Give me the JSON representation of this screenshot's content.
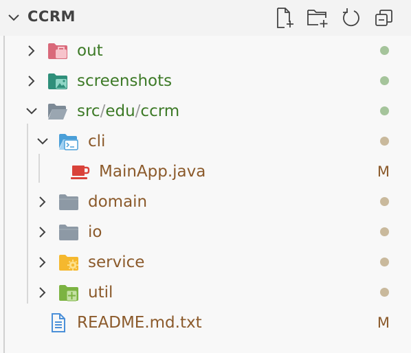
{
  "explorer": {
    "title": "CCRM",
    "actions": [
      {
        "name": "new-file-icon"
      },
      {
        "name": "new-folder-icon"
      },
      {
        "name": "refresh-icon"
      },
      {
        "name": "collapse-all-icon"
      }
    ]
  },
  "tree": [
    {
      "label": "out",
      "type": "folder",
      "expanded": false,
      "status_dot": "#a5c49b"
    },
    {
      "label": "screenshots",
      "type": "folder",
      "expanded": false,
      "status_dot": "#a5c49b"
    },
    {
      "label_parts": [
        "src",
        "edu",
        "ccrm"
      ],
      "separator": "/",
      "type": "folder",
      "expanded": true,
      "status_dot": "#a5c49b"
    },
    {
      "label": "cli",
      "type": "folder",
      "expanded": true,
      "status_dot": "#c9b99c"
    },
    {
      "label": "MainApp.java",
      "type": "file",
      "status": "M"
    },
    {
      "label": "domain",
      "type": "folder",
      "expanded": false,
      "status_dot": "#c9b99c"
    },
    {
      "label": "io",
      "type": "folder",
      "expanded": false,
      "status_dot": "#c9b99c"
    },
    {
      "label": "service",
      "type": "folder",
      "expanded": false,
      "status_dot": "#c9b99c"
    },
    {
      "label": "util",
      "type": "folder",
      "expanded": false,
      "status_dot": "#c9b99c"
    },
    {
      "label": "README.md.txt",
      "type": "file",
      "status": "M"
    }
  ],
  "colors": {
    "green_text": "#3d7a27",
    "modified_text": "#8b5a2b",
    "chevron": "#424242",
    "selection_border": "#d0d0d0"
  }
}
